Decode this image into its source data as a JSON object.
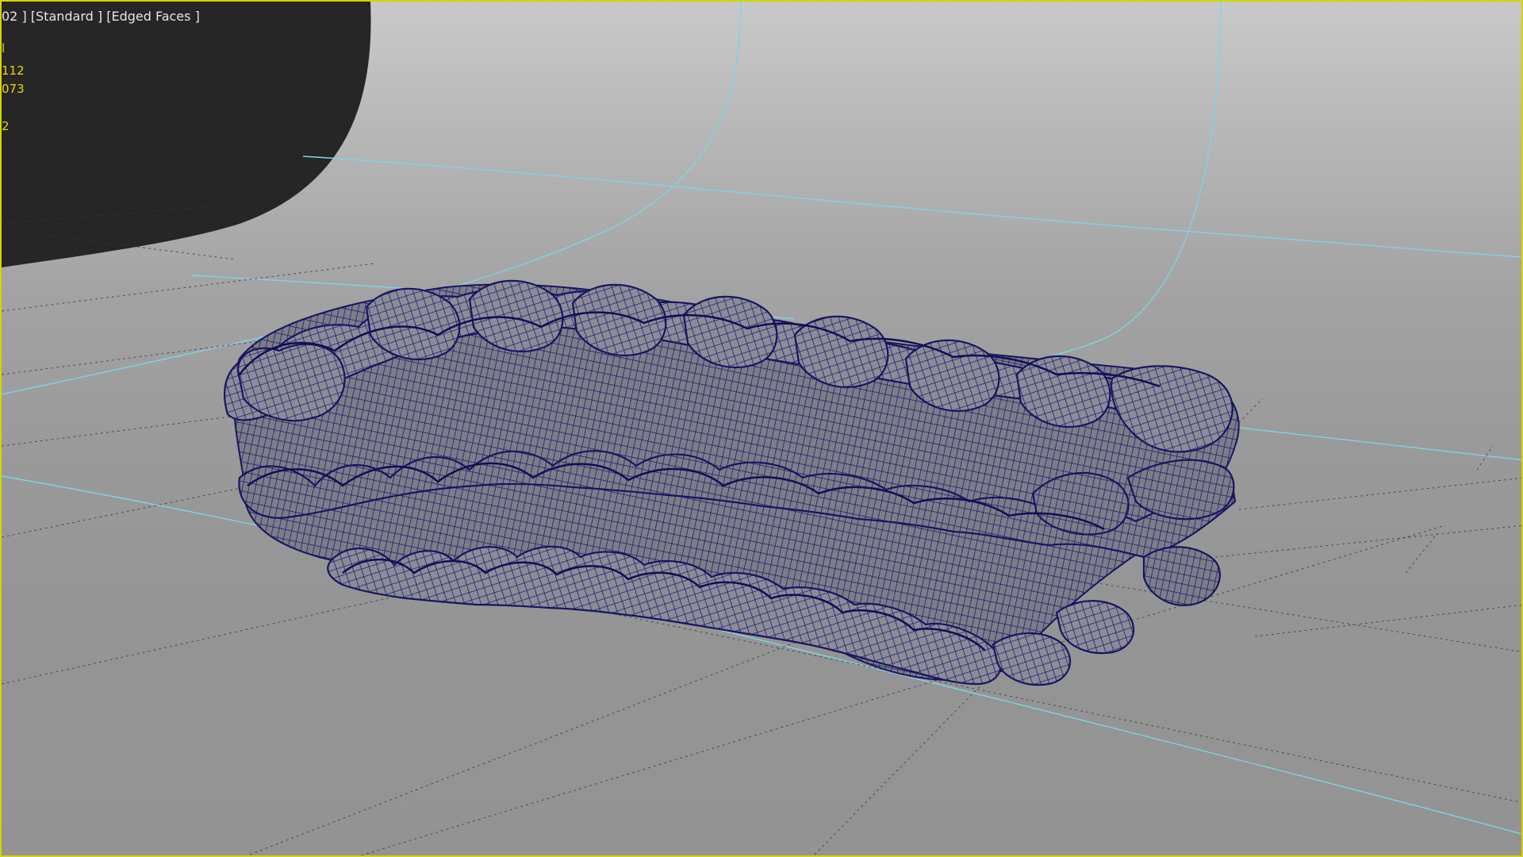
{
  "viewport": {
    "label": "02 ] [Standard ] [Edged Faces ]",
    "colors": {
      "border": "#d4d400",
      "stats_text": "#e8d21a",
      "label_text": "#e6e6e6",
      "mesh_fill": "#7a7a86",
      "mesh_wire": "#1f1f6e",
      "backdrop_edge": "#7fd3e8",
      "background_dark": "#262626"
    },
    "stats": [
      {
        "text": "l"
      },
      {
        "text": "112"
      },
      {
        "text": "073"
      },
      {
        "text": "2"
      }
    ]
  },
  "scene": {
    "object": "wavy-knit-mesh",
    "backdrop": "cyclorama",
    "grid": true
  }
}
